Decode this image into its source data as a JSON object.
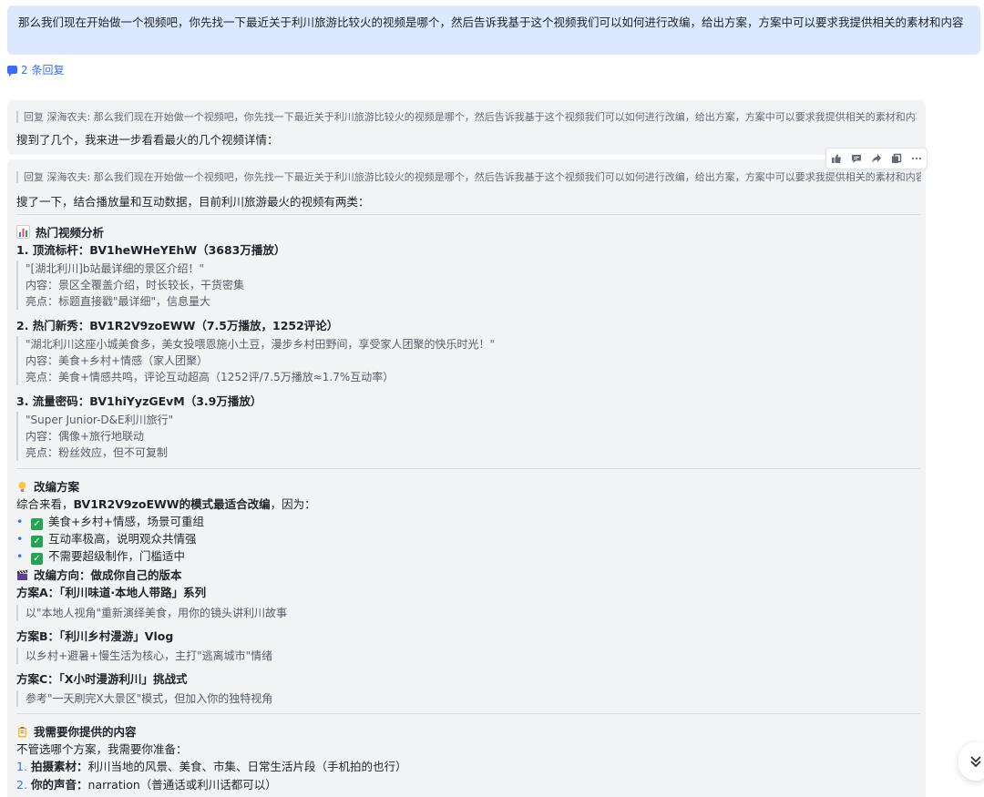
{
  "user_message": "那么我们现在开始做一个视频吧，你先找一下最近关于利川旅游比较火的视频是哪个，然后告诉我基于这个视频我们可以如何进行改编，给出方案，方案中可以要求我提供相关的素材和内容",
  "replies_label": "2 条回复",
  "reply1": {
    "quote": "回复 深海农夫: 那么我们现在开始做一个视频吧，你先找一下最近关于利川旅游比较火的视频是哪个，然后告诉我基于这个视频我们可以如何进行改编，给出方案，方案中可以要求我提供相关的素材和内容",
    "text": "搜到了几个，我来进一步看看最火的几个视频详情："
  },
  "reply2": {
    "quote": "回复 深海农夫: 那么我们现在开始做一个视频吧，你先找一下最近关于利川旅游比较火的视频是哪个，然后告诉我基于这个视频我们可以如何进行改编，给出方案，方案中可以要求我提供相关的素材和内容",
    "intro": "搜了一下，结合播放量和互动数据，目前利川旅游最火的视频有两类：",
    "section_hot": "热门视频分析",
    "videos": [
      {
        "title": "1. 顶流标杆：BV1heWHeYEhW（3683万播放）",
        "lines": [
          "\"[湖北利川]b站最详细的景区介绍！\"",
          "内容：景区全覆盖介绍，时长较长，干货密集",
          "亮点：标题直接戳\"最详细\"，信息量大"
        ]
      },
      {
        "title": "2. 热门新秀：BV1R2V9zoEWW（7.5万播放，1252评论）",
        "lines": [
          "\"湖北利川这座小城美食多，美女投喂恩施小土豆，漫步乡村田野间，享受家人团聚的快乐时光！\"",
          "内容：美食+乡村+情感（家人团聚）",
          "亮点：美食+情感共鸣，评论互动超高（1252评/7.5万播放≈1.7%互动率）"
        ]
      },
      {
        "title": "3. 流量密码：BV1hiYyzGEvM（3.9万播放）",
        "lines": [
          "\"Super Junior-D&E利川旅行\"",
          "内容：偶像+旅行地联动",
          "亮点：粉丝效应，但不可复制"
        ]
      }
    ],
    "section_plan": "改编方案",
    "plan_intro_prefix": "综合来看，",
    "plan_intro_bold": "BV1R2V9zoEWW的模式最适合改编",
    "plan_intro_suffix": "，因为：",
    "reasons": [
      "美食+乡村+情感，场景可重组",
      "互动率极高，说明观众共情强",
      "不需要超级制作，门槛适中"
    ],
    "section_direction": "改编方向：做成你自己的版本",
    "options": [
      {
        "title": "方案A：「利川味道·本地人带路」系列",
        "desc": "以\"本地人视角\"重新演绎美食，用你的镜头讲利川故事"
      },
      {
        "title": "方案B：「利川乡村漫游」Vlog",
        "desc": "以乡村+避暑+慢生活为核心，主打\"逃离城市\"情绪"
      },
      {
        "title": "方案C：「X小时漫游利川」挑战式",
        "desc": "参考\"一天刷完X大景区\"模式，但加入你的独特视角"
      }
    ],
    "section_need": "我需要你提供的内容",
    "need_intro": "不管选哪个方案，我需要你准备：",
    "needs": [
      {
        "num": "1.",
        "label": "拍摄素材：",
        "text": "利川当地的风景、美食、市集、日常生活片段（手机拍的也行）"
      },
      {
        "num": "2.",
        "label": "你的声音：",
        "text": "narration（普通话或利川话都可以）"
      }
    ]
  },
  "toolbar": [
    "thumbs-up",
    "comment",
    "share",
    "copy",
    "more"
  ],
  "colors": {
    "bubble": "#dbe8fd",
    "accent": "#3370ff",
    "card": "#f2f3f5",
    "check": "#22a553"
  }
}
